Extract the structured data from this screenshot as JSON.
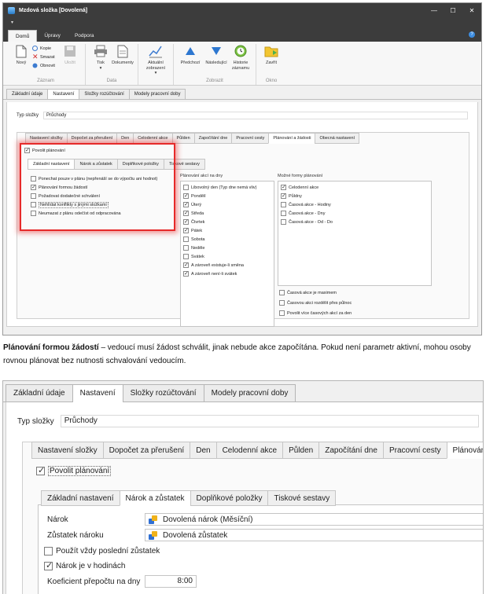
{
  "shot1": {
    "window_title": "Mzdová složka [Dovolená]",
    "quick_access": "▾",
    "window_controls": [
      "—",
      "☐",
      "✕"
    ],
    "menu_tabs": [
      "Domů",
      "Úpravy",
      "Podpora"
    ],
    "help": "?",
    "ribbon": {
      "groups": [
        {
          "label": "Záznam",
          "buttons": [
            "Nový",
            "Uložit"
          ],
          "small": [
            "Kopie",
            "Smazat",
            "Obnovit"
          ]
        },
        {
          "label": "Data",
          "buttons": [
            "Tisk",
            "Dokumenty"
          ]
        },
        {
          "label": "",
          "buttons": [
            "Aktuální zobrazení"
          ]
        },
        {
          "label": "Zobrazit",
          "buttons": [
            "Předchozí",
            "Následující",
            "Historie záznamu"
          ]
        },
        {
          "label": "Okno",
          "buttons": [
            "Zavřít"
          ]
        }
      ],
      "tisk_arrow": "▾",
      "aktualni_arrow": "▾"
    },
    "main_tabs": [
      "Základní údaje",
      "Nastavení",
      "Složky rozúčtování",
      "Modely pracovní doby"
    ],
    "typ_label": "Typ složky",
    "typ_value": "Průchody",
    "inner_tabs": [
      "Nastavení složky",
      "Dopočet za přerušení",
      "Den",
      "Celodenní akce",
      "Půlden",
      "Započítání dne",
      "Pracovní cesty",
      "Plánování a žádosti",
      "Obecná nastavení"
    ],
    "povolit": "Povolit plánování",
    "sub_tabs": [
      "Základní nastavení",
      "Nárok a zůstatek",
      "Doplňkové položky",
      "Tiskové sestavy"
    ],
    "left_options": [
      {
        "label": "Ponechat pouze v plánu (nepřenáší se do výpočtu ani hodnot)",
        "checked": false
      },
      {
        "label": "Plánování formou žádostí",
        "checked": true
      },
      {
        "label": "Požadovat dodatečné schválení",
        "checked": false
      },
      {
        "label": "Nehlídat konflikty s jinými složkami",
        "checked": false
      },
      {
        "label": "Neumazat z plánu odečíst od odpracována",
        "checked": false
      }
    ],
    "days_header": "Plánování akcí na dny",
    "days": [
      {
        "label": "Libovolný den (Typ dne nemá vliv)",
        "checked": false
      },
      {
        "label": "Pondělí",
        "checked": true
      },
      {
        "label": "Úterý",
        "checked": true
      },
      {
        "label": "Středa",
        "checked": true
      },
      {
        "label": "Čtvrtek",
        "checked": true
      },
      {
        "label": "Pátek",
        "checked": true
      },
      {
        "label": "Sobota",
        "checked": false
      },
      {
        "label": "Neděle",
        "checked": false
      },
      {
        "label": "Svátek",
        "checked": false
      },
      {
        "label": "A zároveň existuje-li směna",
        "checked": true
      },
      {
        "label": "A zároveň není-li svátek",
        "checked": true
      }
    ],
    "forms_header": "Možné formy plánování",
    "forms": [
      {
        "label": "Celodenní akce",
        "checked": true
      },
      {
        "label": "Půldny",
        "checked": true
      },
      {
        "label": "Časová akce - Hodiny",
        "checked": false
      },
      {
        "label": "Časová akce - Dny",
        "checked": false
      },
      {
        "label": "Časová akce - Od - Do",
        "checked": false
      }
    ],
    "extra_options": [
      {
        "label": "Časová akce je maximem",
        "checked": false
      },
      {
        "label": "Časovou akci rozdělit přes půlnoc",
        "checked": false
      },
      {
        "label": "Povolit více časových akcí za den",
        "checked": false
      }
    ]
  },
  "description": {
    "bold": "Plánování formou žádostí",
    "text": " – vedoucí musí žádost schválit, jinak nebude akce započítána. Pokud není parametr aktivní, mohou osoby rovnou plánovat bez nutnosti schvalování vedoucím."
  },
  "shot2": {
    "main_tabs": [
      "Základní údaje",
      "Nastavení",
      "Složky rozúčtování",
      "Modely pracovní doby"
    ],
    "typ_label": "Typ složky",
    "typ_value": "Průchody",
    "inner_tabs": [
      "Nastavení složky",
      "Dopočet za přerušení",
      "Den",
      "Celodenní akce",
      "Půlden",
      "Započítání dne",
      "Pracovní cesty",
      "Plánování a žádosti"
    ],
    "povolit": "Povolit plánování",
    "sub_tabs": [
      "Základní nastavení",
      "Nárok a zůstatek",
      "Doplňkové položky",
      "Tiskové sestavy"
    ],
    "narok_label": "Nárok",
    "narok_value": "Dovolená nárok (Měsíční)",
    "zustatek_label": "Zůstatek nároku",
    "zustatek_value": "Dovolená zůstatek",
    "pouzit": {
      "label": "Použít vždy poslední zůstatek",
      "checked": false
    },
    "narok_hod": {
      "label": "Nárok je v hodinách",
      "checked": true
    },
    "koef_label": "Koeficient přepočtu na dny",
    "koef_value": "8:00"
  }
}
